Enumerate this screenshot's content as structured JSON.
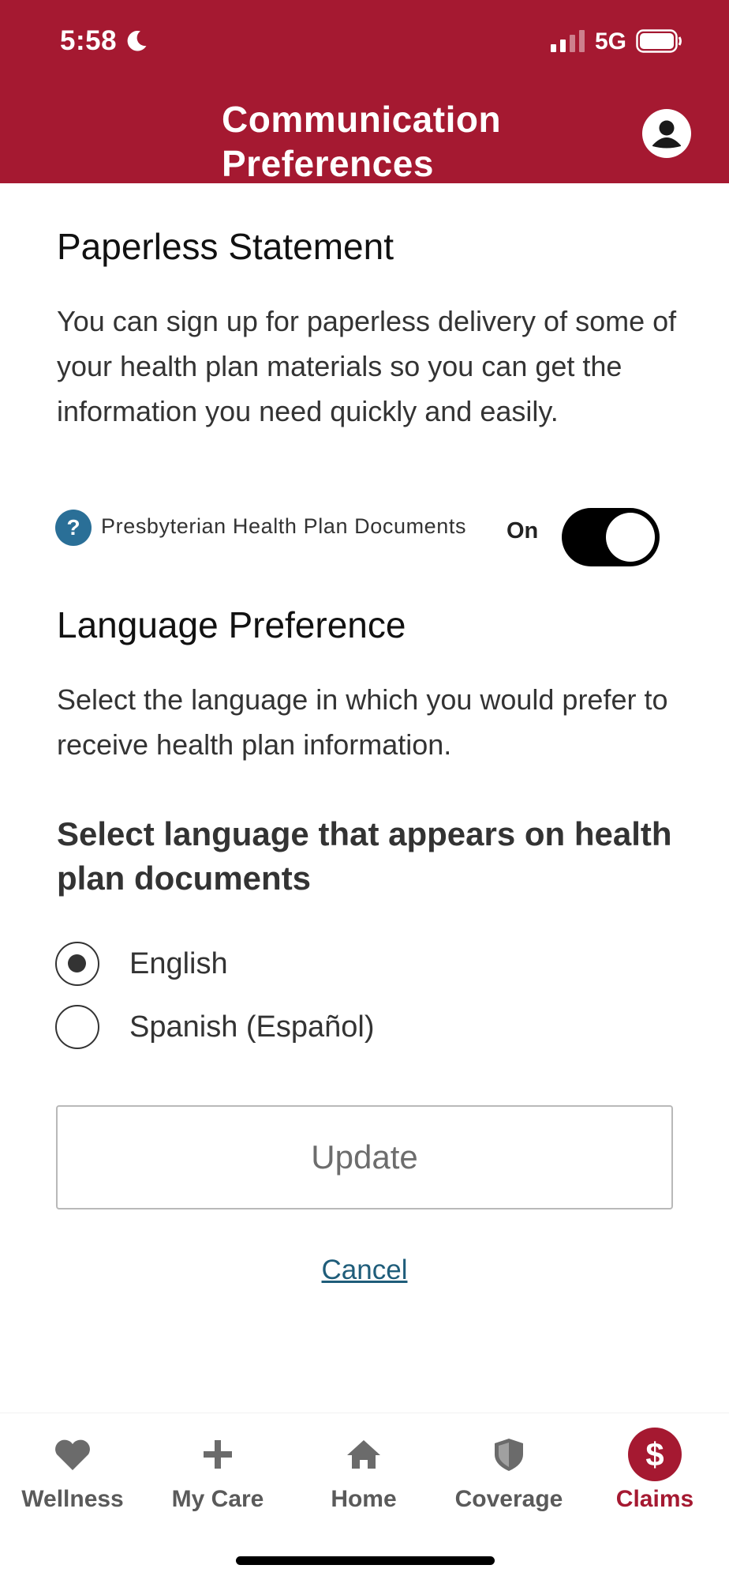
{
  "status_bar": {
    "time": "5:58",
    "network": "5G"
  },
  "header": {
    "title_line1": "Communication",
    "title_line2": "Preferences"
  },
  "paperless": {
    "heading": "Paperless Statement",
    "description": "You can sign up for paperless delivery of some of your health plan materials so you can get the information you need quickly and easily.",
    "document_label": "Presbyterian Health Plan Documents",
    "toggle_state_label": "On",
    "toggle_on": true
  },
  "language": {
    "heading": "Language Preference",
    "description": "Select the language in which you would prefer to receive health plan information.",
    "select_heading": "Select language that appears on health plan documents",
    "options": [
      {
        "label": "English",
        "selected": true
      },
      {
        "label": "Spanish (Español)",
        "selected": false
      }
    ]
  },
  "actions": {
    "update_label": "Update",
    "cancel_label": "Cancel"
  },
  "tabbar": {
    "tabs": [
      {
        "label": "Wellness",
        "icon": "heart-icon"
      },
      {
        "label": "My Care",
        "icon": "plus-icon"
      },
      {
        "label": "Home",
        "icon": "home-icon"
      },
      {
        "label": "Coverage",
        "icon": "shield-icon"
      },
      {
        "label": "Claims",
        "icon": "dollar-icon",
        "active": true
      }
    ]
  },
  "colors": {
    "brand": "#a51931",
    "link": "#1f5d7a",
    "help_icon": "#2a6f97"
  }
}
